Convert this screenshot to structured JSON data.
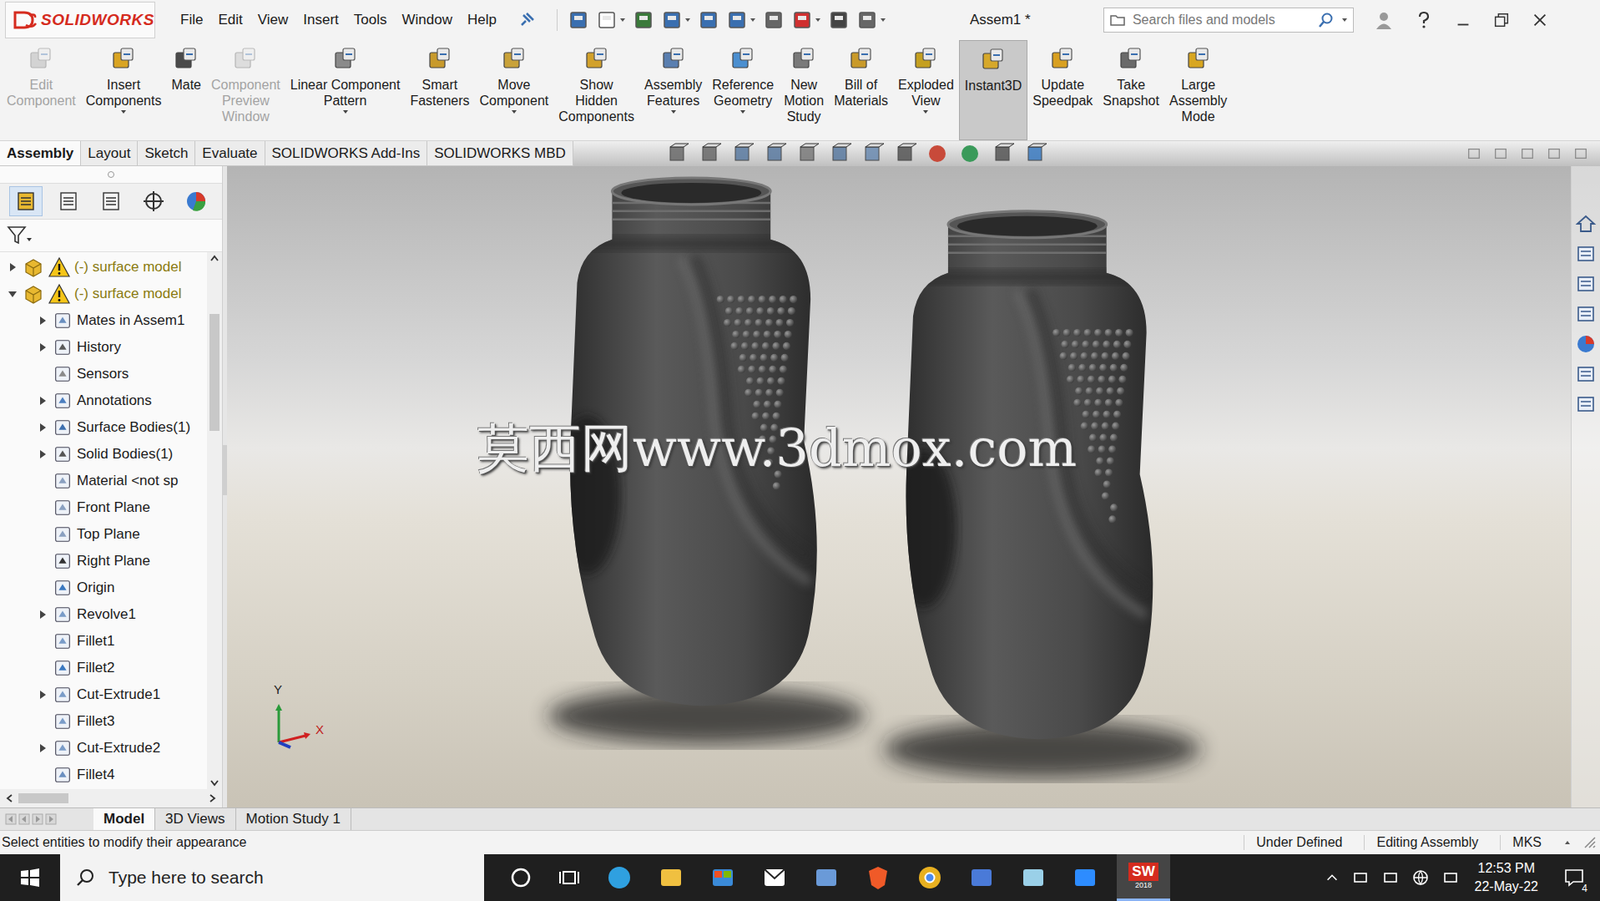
{
  "app": {
    "logo": "SOLIDWORKS"
  },
  "menu": [
    "File",
    "Edit",
    "View",
    "Insert",
    "Tools",
    "Window",
    "Help"
  ],
  "window": {
    "title": "Assem1 *"
  },
  "search": {
    "placeholder": "Search files and models"
  },
  "ribbon": [
    {
      "lines": [
        "Edit",
        "Component"
      ],
      "disabled": true,
      "dropdown": false,
      "selected": false
    },
    {
      "lines": [
        "Insert",
        "Components"
      ],
      "disabled": false,
      "dropdown": true,
      "selected": false
    },
    {
      "lines": [
        "Mate"
      ],
      "disabled": false,
      "dropdown": false,
      "selected": false
    },
    {
      "lines": [
        "Component",
        "Preview",
        "Window"
      ],
      "disabled": true,
      "dropdown": false,
      "selected": false
    },
    {
      "lines": [
        "Linear Component",
        "Pattern"
      ],
      "disabled": false,
      "dropdown": true,
      "selected": false
    },
    {
      "lines": [
        "Smart",
        "Fasteners"
      ],
      "disabled": false,
      "dropdown": false,
      "selected": false
    },
    {
      "lines": [
        "Move",
        "Component"
      ],
      "disabled": false,
      "dropdown": true,
      "selected": false
    },
    {
      "lines": [
        "Show",
        "Hidden",
        "Components"
      ],
      "disabled": false,
      "dropdown": false,
      "selected": false
    },
    {
      "lines": [
        "Assembly",
        "Features"
      ],
      "disabled": false,
      "dropdown": true,
      "selected": false
    },
    {
      "lines": [
        "Reference",
        "Geometry"
      ],
      "disabled": false,
      "dropdown": true,
      "selected": false
    },
    {
      "lines": [
        "New",
        "Motion",
        "Study"
      ],
      "disabled": false,
      "dropdown": false,
      "selected": false
    },
    {
      "lines": [
        "Bill of",
        "Materials"
      ],
      "disabled": false,
      "dropdown": false,
      "selected": false
    },
    {
      "lines": [
        "Exploded",
        "View"
      ],
      "disabled": false,
      "dropdown": true,
      "selected": false
    },
    {
      "lines": [
        "Instant3D"
      ],
      "disabled": false,
      "dropdown": false,
      "selected": true
    },
    {
      "lines": [
        "Update",
        "Speedpak"
      ],
      "disabled": false,
      "dropdown": false,
      "selected": false
    },
    {
      "lines": [
        "Take",
        "Snapshot"
      ],
      "disabled": false,
      "dropdown": false,
      "selected": false
    },
    {
      "lines": [
        "Large",
        "Assembly",
        "Mode"
      ],
      "disabled": false,
      "dropdown": false,
      "selected": false
    }
  ],
  "tabs": [
    {
      "label": "Assembly",
      "selected": true
    },
    {
      "label": "Layout",
      "selected": false
    },
    {
      "label": "Sketch",
      "selected": false
    },
    {
      "label": "Evaluate",
      "selected": false
    },
    {
      "label": "SOLIDWORKS Add-Ins",
      "selected": false
    },
    {
      "label": "SOLIDWORKS MBD",
      "selected": false
    }
  ],
  "tree": [
    {
      "label": "(-) surface model",
      "kind": "component",
      "level": 0,
      "expandable": true,
      "expanded": false,
      "warning": true
    },
    {
      "label": "(-) surface model",
      "kind": "component",
      "level": 0,
      "expandable": true,
      "expanded": true,
      "warning": true
    },
    {
      "label": "Mates in Assem1",
      "kind": "feature",
      "level": 1,
      "expandable": true,
      "expanded": false,
      "warning": false
    },
    {
      "label": "History",
      "kind": "feature",
      "level": 1,
      "expandable": true,
      "expanded": false,
      "warning": false
    },
    {
      "label": "Sensors",
      "kind": "feature",
      "level": 1,
      "expandable": false,
      "expanded": false,
      "warning": false
    },
    {
      "label": "Annotations",
      "kind": "feature",
      "level": 1,
      "expandable": true,
      "expanded": false,
      "warning": false
    },
    {
      "label": "Surface Bodies(1)",
      "kind": "feature",
      "level": 1,
      "expandable": true,
      "expanded": false,
      "warning": false
    },
    {
      "label": "Solid Bodies(1)",
      "kind": "feature",
      "level": 1,
      "expandable": true,
      "expanded": false,
      "warning": false
    },
    {
      "label": "Material <not sp",
      "kind": "feature",
      "level": 1,
      "expandable": false,
      "expanded": false,
      "warning": false
    },
    {
      "label": "Front Plane",
      "kind": "feature",
      "level": 1,
      "expandable": false,
      "expanded": false,
      "warning": false
    },
    {
      "label": "Top Plane",
      "kind": "feature",
      "level": 1,
      "expandable": false,
      "expanded": false,
      "warning": false
    },
    {
      "label": "Right Plane",
      "kind": "feature",
      "level": 1,
      "expandable": false,
      "expanded": false,
      "warning": false
    },
    {
      "label": "Origin",
      "kind": "feature",
      "level": 1,
      "expandable": false,
      "expanded": false,
      "warning": false
    },
    {
      "label": "Revolve1",
      "kind": "feature",
      "level": 1,
      "expandable": true,
      "expanded": false,
      "warning": false
    },
    {
      "label": "Fillet1",
      "kind": "feature",
      "level": 1,
      "expandable": false,
      "expanded": false,
      "warning": false
    },
    {
      "label": "Fillet2",
      "kind": "feature",
      "level": 1,
      "expandable": false,
      "expanded": false,
      "warning": false
    },
    {
      "label": "Cut-Extrude1",
      "kind": "feature",
      "level": 1,
      "expandable": true,
      "expanded": false,
      "warning": false
    },
    {
      "label": "Fillet3",
      "kind": "feature",
      "level": 1,
      "expandable": false,
      "expanded": false,
      "warning": false
    },
    {
      "label": "Cut-Extrude2",
      "kind": "feature",
      "level": 1,
      "expandable": true,
      "expanded": false,
      "warning": false
    },
    {
      "label": "Fillet4",
      "kind": "feature",
      "level": 1,
      "expandable": false,
      "expanded": false,
      "warning": false
    }
  ],
  "watermark": "莫西网www.3dmox.com",
  "triad": {
    "y": "Y",
    "x": "X"
  },
  "bottom_tabs": [
    {
      "label": "Model",
      "selected": true
    },
    {
      "label": "3D Views",
      "selected": false
    },
    {
      "label": "Motion Study 1",
      "selected": false
    }
  ],
  "status_bar": {
    "message": "Select entities to modify their appearance",
    "items": [
      "Under Defined",
      "Editing Assembly",
      "MKS"
    ]
  },
  "taskbar": {
    "search_placeholder": "Type here to search",
    "sw_label": "SW",
    "sw_version": "2018",
    "time": "12:53 PM",
    "date": "22-May-22",
    "notifications": "4"
  }
}
